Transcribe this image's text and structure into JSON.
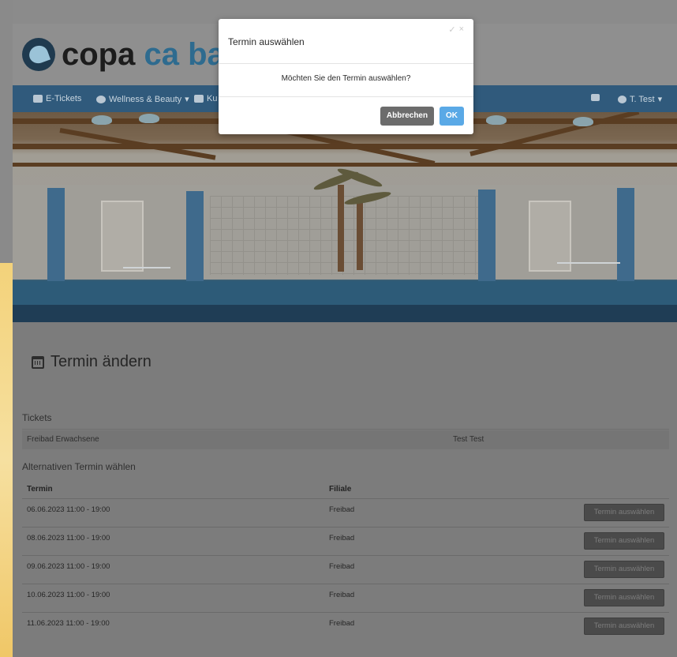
{
  "brand": {
    "part1": "copa",
    "part2": "ca back"
  },
  "nav": {
    "items": [
      {
        "label": "E-Tickets",
        "icon": "ticket-icon"
      },
      {
        "label": "Wellness & Beauty",
        "icon": "heart-icon",
        "caret": "▾"
      },
      {
        "label": "Ku",
        "icon": "list-icon"
      }
    ],
    "cart_icon": "cart-icon",
    "user": {
      "label": "T. Test",
      "icon": "gears-icon",
      "caret": "▾"
    }
  },
  "page": {
    "title": "Termin ändern",
    "tickets_label": "Tickets",
    "ticket_name": "Freibad Erwachsene",
    "ticket_holder": "Test Test",
    "alt_label": "Alternativen Termin wählen",
    "columns": {
      "termin": "Termin",
      "filiale": "Filiale"
    },
    "rows": [
      {
        "termin": "06.06.2023 11:00 - 19:00",
        "filiale": "Freibad",
        "button": "Termin auswählen"
      },
      {
        "termin": "08.06.2023 11:00 - 19:00",
        "filiale": "Freibad",
        "button": "Termin auswählen"
      },
      {
        "termin": "09.06.2023 11:00 - 19:00",
        "filiale": "Freibad",
        "button": "Termin auswählen"
      },
      {
        "termin": "10.06.2023 11:00 - 19:00",
        "filiale": "Freibad",
        "button": "Termin auswählen"
      },
      {
        "termin": "11.06.2023 11:00 - 19:00",
        "filiale": "Freibad",
        "button": "Termin auswählen"
      }
    ]
  },
  "modal": {
    "title": "Termin auswählen",
    "check_icon": "✓",
    "close_icon": "×",
    "message": "Möchten Sie den Termin auswählen?",
    "cancel_label": "Abbrechen",
    "ok_label": "OK"
  },
  "colors": {
    "navbar": "#305a7c",
    "ok": "#5aa9e6",
    "cancel": "#6c6c6c",
    "brand_blue": "#2e6b8f"
  }
}
